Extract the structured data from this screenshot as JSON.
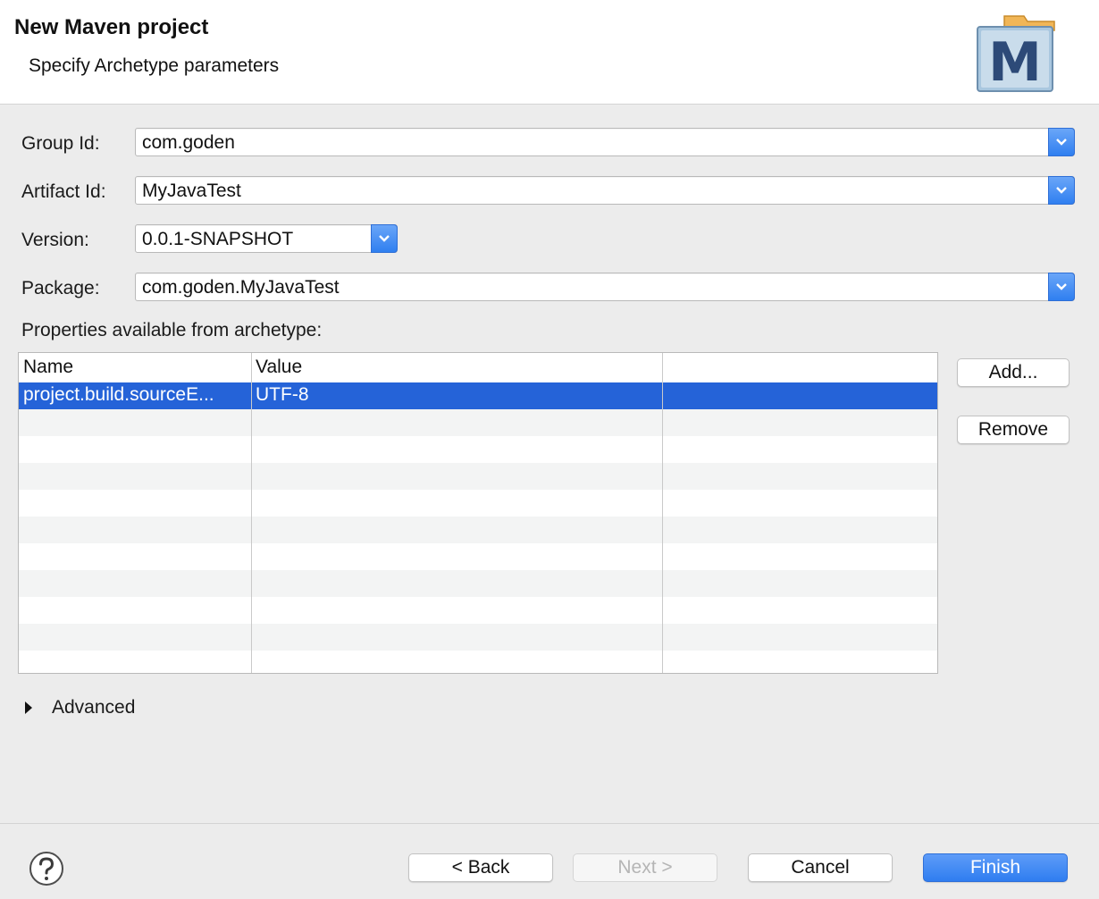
{
  "header": {
    "title": "New Maven project",
    "subtitle": "Specify Archetype parameters",
    "logo_letter": "M"
  },
  "form": {
    "group_id": {
      "label": "Group Id:",
      "value": "com.goden"
    },
    "artifact_id": {
      "label": "Artifact Id:",
      "value": "MyJavaTest"
    },
    "version": {
      "label": "Version:",
      "value": "0.0.1-SNAPSHOT"
    },
    "package": {
      "label": "Package:",
      "value": "com.goden.MyJavaTest"
    }
  },
  "properties": {
    "label": "Properties available from archetype:",
    "columns": [
      "Name",
      "Value",
      ""
    ],
    "rows": [
      {
        "name": "project.build.sourceE...",
        "value": "UTF-8",
        "selected": true
      }
    ],
    "add_label": "Add...",
    "remove_label": "Remove"
  },
  "advanced": {
    "label": "Advanced"
  },
  "footer": {
    "back_label": "< Back",
    "next_label": "Next >",
    "cancel_label": "Cancel",
    "finish_label": "Finish"
  },
  "colors": {
    "accent": "#2f7ff0",
    "selection": "#2563d8",
    "dialog_bg": "#ececec"
  }
}
